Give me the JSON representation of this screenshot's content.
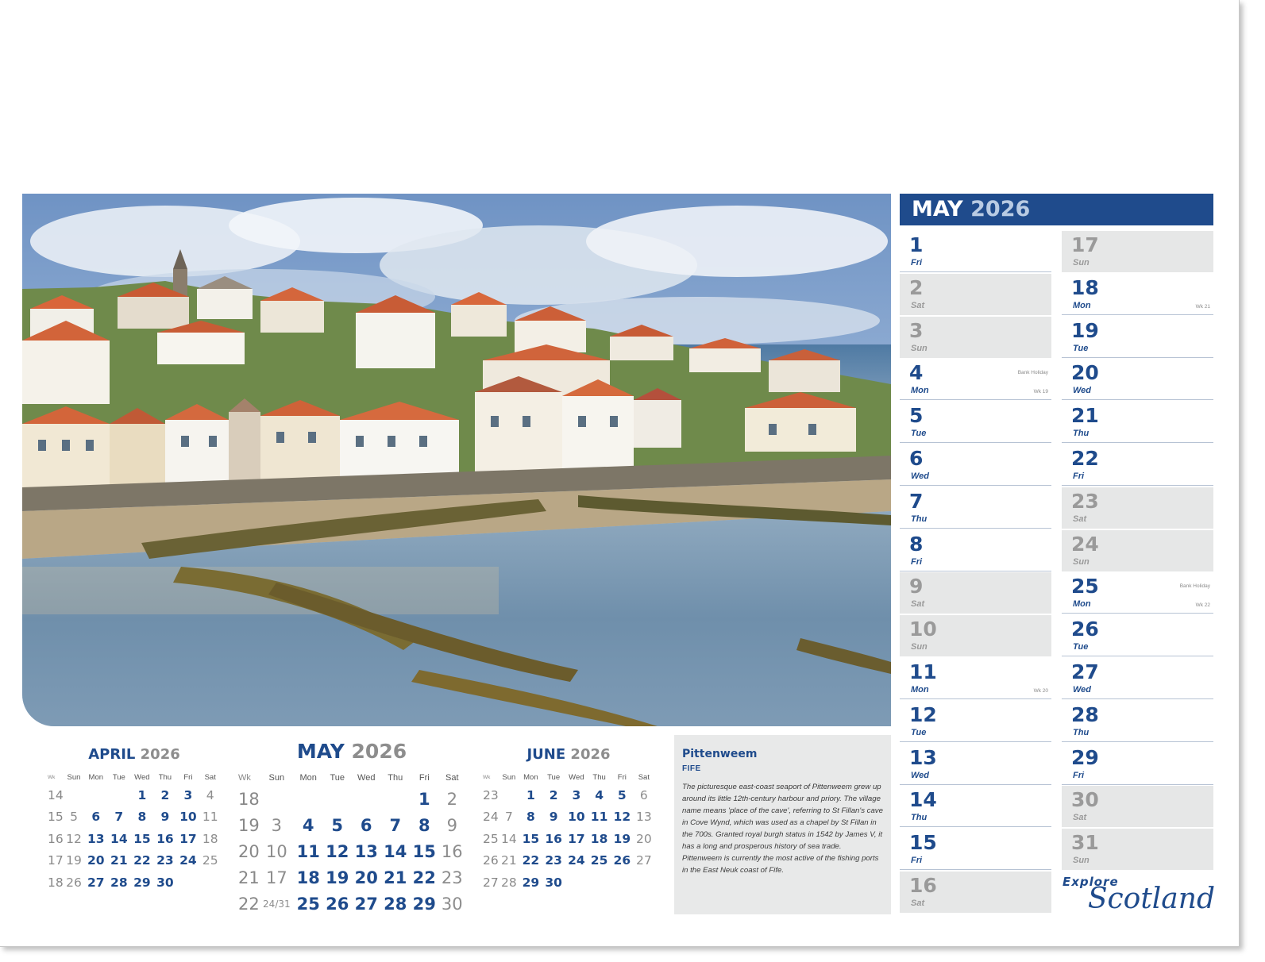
{
  "photo": {
    "subject": "Pittenweem harbour"
  },
  "month_header": {
    "month": "MAY",
    "year": "2026"
  },
  "days": [
    {
      "n": "1",
      "d": "Fri",
      "we": false
    },
    {
      "n": "2",
      "d": "Sat",
      "we": true
    },
    {
      "n": "3",
      "d": "Sun",
      "we": true
    },
    {
      "n": "4",
      "d": "Mon",
      "we": false,
      "note": "Bank Holiday",
      "wk": "Wk 19"
    },
    {
      "n": "5",
      "d": "Tue",
      "we": false
    },
    {
      "n": "6",
      "d": "Wed",
      "we": false
    },
    {
      "n": "7",
      "d": "Thu",
      "we": false
    },
    {
      "n": "8",
      "d": "Fri",
      "we": false
    },
    {
      "n": "9",
      "d": "Sat",
      "we": true
    },
    {
      "n": "10",
      "d": "Sun",
      "we": true
    },
    {
      "n": "11",
      "d": "Mon",
      "we": false,
      "wk": "Wk 20"
    },
    {
      "n": "12",
      "d": "Tue",
      "we": false
    },
    {
      "n": "13",
      "d": "Wed",
      "we": false
    },
    {
      "n": "14",
      "d": "Thu",
      "we": false
    },
    {
      "n": "15",
      "d": "Fri",
      "we": false
    },
    {
      "n": "16",
      "d": "Sat",
      "we": true
    },
    {
      "n": "17",
      "d": "Sun",
      "we": true
    },
    {
      "n": "18",
      "d": "Mon",
      "we": false,
      "wk": "Wk 21"
    },
    {
      "n": "19",
      "d": "Tue",
      "we": false
    },
    {
      "n": "20",
      "d": "Wed",
      "we": false
    },
    {
      "n": "21",
      "d": "Thu",
      "we": false
    },
    {
      "n": "22",
      "d": "Fri",
      "we": false
    },
    {
      "n": "23",
      "d": "Sat",
      "we": true
    },
    {
      "n": "24",
      "d": "Sun",
      "we": true
    },
    {
      "n": "25",
      "d": "Mon",
      "we": false,
      "note": "Bank Holiday",
      "wk": "Wk 22"
    },
    {
      "n": "26",
      "d": "Tue",
      "we": false
    },
    {
      "n": "27",
      "d": "Wed",
      "we": false
    },
    {
      "n": "28",
      "d": "Thu",
      "we": false
    },
    {
      "n": "29",
      "d": "Fri",
      "we": false
    },
    {
      "n": "30",
      "d": "Sat",
      "we": true
    },
    {
      "n": "31",
      "d": "Sun",
      "we": true
    }
  ],
  "mini_calendars": {
    "april": {
      "month": "APRIL",
      "year": "2026",
      "headers": [
        "Wk",
        "Sun",
        "Mon",
        "Tue",
        "Wed",
        "Thu",
        "Fri",
        "Sat"
      ],
      "rows": [
        [
          "14",
          "",
          "",
          "",
          "1",
          "2",
          "3",
          "4"
        ],
        [
          "15",
          "5",
          "6",
          "7",
          "8",
          "9",
          "10",
          "11"
        ],
        [
          "16",
          "12",
          "13",
          "14",
          "15",
          "16",
          "17",
          "18"
        ],
        [
          "17",
          "19",
          "20",
          "21",
          "22",
          "23",
          "24",
          "25"
        ],
        [
          "18",
          "26",
          "27",
          "28",
          "29",
          "30",
          "",
          ""
        ]
      ]
    },
    "may": {
      "month": "MAY",
      "year": "2026",
      "headers": [
        "Wk",
        "Sun",
        "Mon",
        "Tue",
        "Wed",
        "Thu",
        "Fri",
        "Sat"
      ],
      "rows": [
        [
          "18",
          "",
          "",
          "",
          "",
          "",
          "1",
          "2"
        ],
        [
          "19",
          "3",
          "4",
          "5",
          "6",
          "7",
          "8",
          "9"
        ],
        [
          "20",
          "10",
          "11",
          "12",
          "13",
          "14",
          "15",
          "16"
        ],
        [
          "21",
          "17",
          "18",
          "19",
          "20",
          "21",
          "22",
          "23"
        ],
        [
          "22",
          "24/31",
          "25",
          "26",
          "27",
          "28",
          "29",
          "30"
        ]
      ]
    },
    "june": {
      "month": "JUNE",
      "year": "2026",
      "headers": [
        "Wk",
        "Sun",
        "Mon",
        "Tue",
        "Wed",
        "Thu",
        "Fri",
        "Sat"
      ],
      "rows": [
        [
          "23",
          "",
          "1",
          "2",
          "3",
          "4",
          "5",
          "6"
        ],
        [
          "24",
          "7",
          "8",
          "9",
          "10",
          "11",
          "12",
          "13"
        ],
        [
          "25",
          "14",
          "15",
          "16",
          "17",
          "18",
          "19",
          "20"
        ],
        [
          "26",
          "21",
          "22",
          "23",
          "24",
          "25",
          "26",
          "27"
        ],
        [
          "27",
          "28",
          "29",
          "30",
          "",
          "",
          "",
          ""
        ]
      ]
    }
  },
  "info": {
    "title": "Pittenweem",
    "subtitle": "FIFE",
    "description": "The picturesque east-coast seaport of Pittenweem grew up around its little 12th-century harbour and priory. The village name means 'place of the cave', referring to St Fillan's cave in Cove Wynd, which was used as a chapel by St Fillan in the 700s. Granted royal burgh status in 1542 by James V, it has a long and prosperous history of sea trade. Pittenweem is currently the most active of the fishing ports in the East Neuk coast of Fife."
  },
  "brand": {
    "explore": "Explore",
    "scotland": "Scotland"
  },
  "colors": {
    "accent": "#1f4b8c",
    "weekend_bg": "#e6e7e7",
    "weekend_text": "#9a9a9a"
  }
}
